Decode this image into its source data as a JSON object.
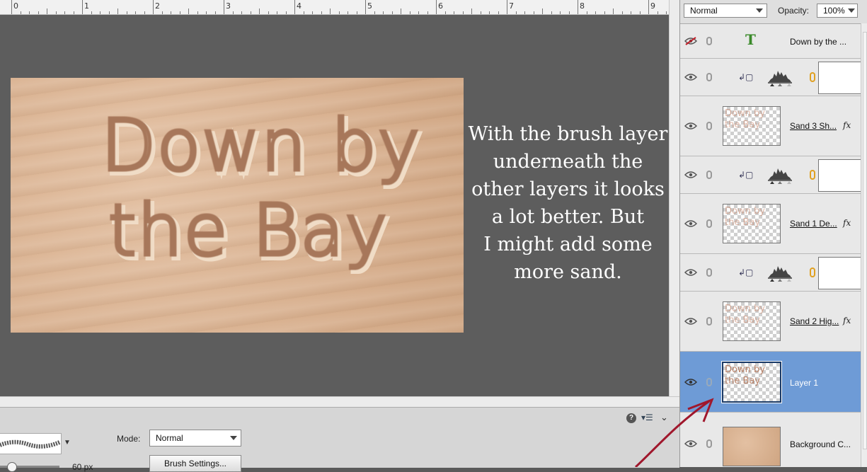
{
  "ruler": {
    "labels": [
      "0",
      "1",
      "2",
      "3",
      "4",
      "5",
      "6",
      "7",
      "8",
      "9"
    ]
  },
  "canvas": {
    "sand_text_line1": "Down by",
    "sand_text_line2": "the Bay",
    "caption_lines": [
      "With the brush layer",
      "underneath the",
      "other layers it looks",
      "a lot better. But",
      "I might add some",
      "more sand."
    ]
  },
  "layers_panel": {
    "blend_mode": "Normal",
    "opacity_label": "Opacity:",
    "opacity_value": "100%",
    "layers": [
      {
        "name": "Down by the ...",
        "type": "text"
      },
      {
        "name": "",
        "type": "adjustment"
      },
      {
        "name": "Sand 3 Sh...",
        "type": "image",
        "fx": "fx"
      },
      {
        "name": "",
        "type": "adjustment"
      },
      {
        "name": "Sand 1 De...",
        "type": "image",
        "fx": "fx"
      },
      {
        "name": "",
        "type": "adjustment"
      },
      {
        "name": "Sand 2 Hig...",
        "type": "image",
        "fx": "fx"
      },
      {
        "name": "Layer 1",
        "type": "image",
        "selected": true
      },
      {
        "name": "Background C...",
        "type": "background"
      }
    ],
    "thumb_text_line1": "Down by",
    "thumb_text_line2": "the Bay"
  },
  "tool_options": {
    "mode_label": "Mode:",
    "mode_value": "Normal",
    "brush_settings_label": "Brush Settings...",
    "size_value": "60 px"
  },
  "colors": {
    "selected_layer": "#6e9bd6",
    "annotation_arrow": "#a0172c"
  }
}
